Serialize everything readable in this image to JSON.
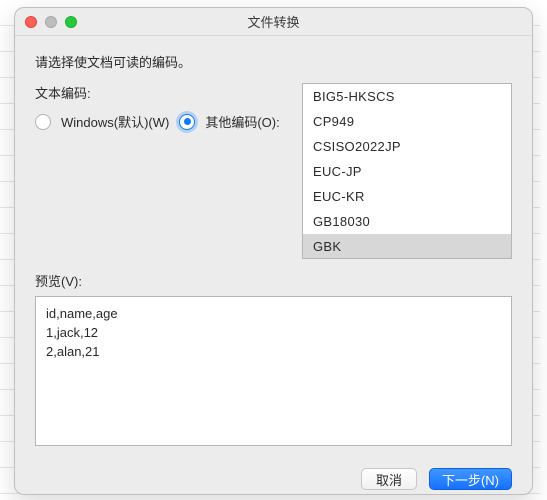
{
  "window": {
    "title": "文件转换"
  },
  "instruction": "请选择使文档可读的编码。",
  "encoding": {
    "section_label": "文本编码:",
    "radios": {
      "windows": {
        "label": "Windows(默认)(W)",
        "selected": false
      },
      "other": {
        "label": "其他编码(O):",
        "selected": true
      }
    },
    "list": {
      "items": [
        "BIG5-HKSCS",
        "CP949",
        "CSISO2022JP",
        "EUC-JP",
        "EUC-KR",
        "GB18030",
        "GBK"
      ],
      "selected_index": 6
    }
  },
  "preview": {
    "label": "预览(V):",
    "text": "id,name,age\n1,jack,12\n2,alan,21"
  },
  "buttons": {
    "cancel": "取消",
    "next": "下一步(N)"
  }
}
